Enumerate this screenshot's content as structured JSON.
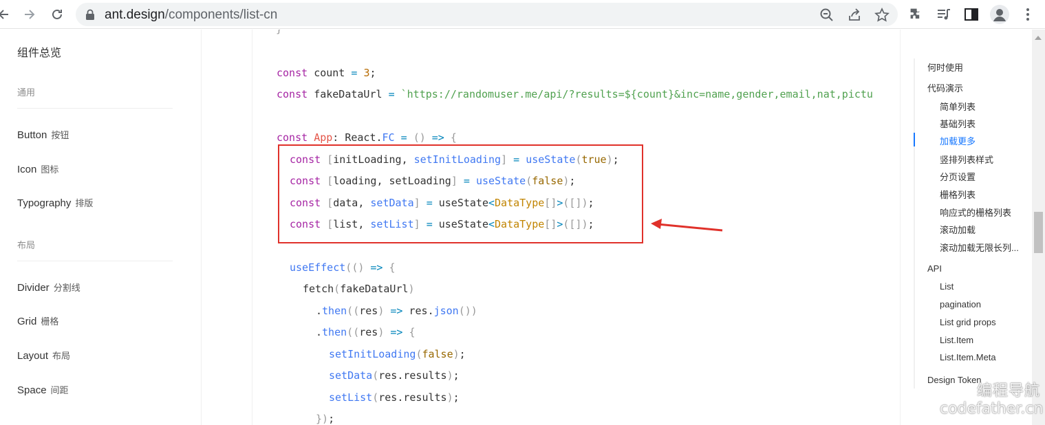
{
  "browser": {
    "url_host": "ant.design",
    "url_path": "/components/list-cn"
  },
  "sidebar": {
    "overview": "组件总览",
    "groups": [
      {
        "label": "通用"
      },
      {
        "label": "布局"
      }
    ],
    "items": [
      {
        "en": "Button",
        "cn": "按钮"
      },
      {
        "en": "Icon",
        "cn": "图标"
      },
      {
        "en": "Typography",
        "cn": "排版"
      },
      {
        "en": "Divider",
        "cn": "分割线"
      },
      {
        "en": "Grid",
        "cn": "栅格"
      },
      {
        "en": "Layout",
        "cn": "布局"
      },
      {
        "en": "Space",
        "cn": "间距"
      }
    ]
  },
  "code": {
    "lines": [
      "}",
      "const count = 3;",
      "const fakeDataUrl = `https://randomuser.me/api/?results=${count}&inc=name,gender,email,nat,pictu",
      "const App: React.FC = () => {",
      "const [initLoading, setInitLoading] = useState(true);",
      "const [loading, setLoading] = useState(false);",
      "const [data, setData] = useState<DataType[]>([]);",
      "const [list, setList] = useState<DataType[]>([]);",
      "useEffect(() => {",
      "fetch(fakeDataUrl)",
      ".then((res) => res.json())",
      ".then((res) => {",
      "setInitLoading(false);",
      "setData(res.results);",
      "setList(res.results);",
      "});"
    ]
  },
  "toc": {
    "items": [
      {
        "label": "何时使用",
        "level": 1
      },
      {
        "label": "代码演示",
        "level": 1
      },
      {
        "label": "简单列表",
        "level": 2
      },
      {
        "label": "基础列表",
        "level": 2
      },
      {
        "label": "加载更多",
        "level": 2,
        "active": true
      },
      {
        "label": "竖排列表样式",
        "level": 2
      },
      {
        "label": "分页设置",
        "level": 2
      },
      {
        "label": "栅格列表",
        "level": 2
      },
      {
        "label": "响应式的栅格列表",
        "level": 2
      },
      {
        "label": "滚动加载",
        "level": 2
      },
      {
        "label": "滚动加载无限长列...",
        "level": 2
      },
      {
        "label": "API",
        "level": 1
      },
      {
        "label": "List",
        "level": 2
      },
      {
        "label": "pagination",
        "level": 2
      },
      {
        "label": "List grid props",
        "level": 2
      },
      {
        "label": "List.Item",
        "level": 2
      },
      {
        "label": "List.Item.Meta",
        "level": 2
      },
      {
        "label": "Design Token",
        "level": 1
      }
    ]
  },
  "watermark": {
    "cn": "编程导航",
    "en": "codefather.cn"
  },
  "colors": {
    "highlight_border": "#e0312a",
    "toc_active": "#1677ff"
  }
}
